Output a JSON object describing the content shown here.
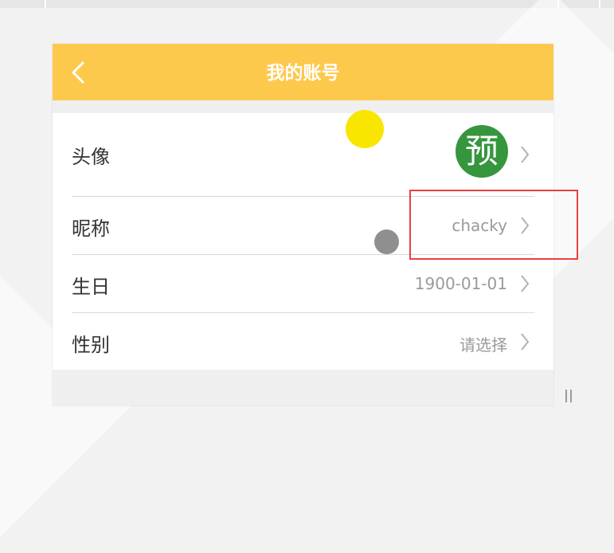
{
  "header": {
    "title": "我的账号",
    "back_icon": "chevron-left-icon"
  },
  "profile": {
    "avatar": {
      "label": "头像",
      "glyph": "预",
      "color": "#36963d"
    },
    "nickname": {
      "label": "昵称",
      "value": "chacky"
    },
    "birthday": {
      "label": "生日",
      "value": "1900-01-01"
    },
    "gender": {
      "label": "性别",
      "value": "请选择"
    }
  },
  "colors": {
    "header_background": "#fdc94d",
    "highlight_border": "#e8413f",
    "marker_yellow": "#f9e600",
    "marker_gray": "#8f8f8f"
  }
}
